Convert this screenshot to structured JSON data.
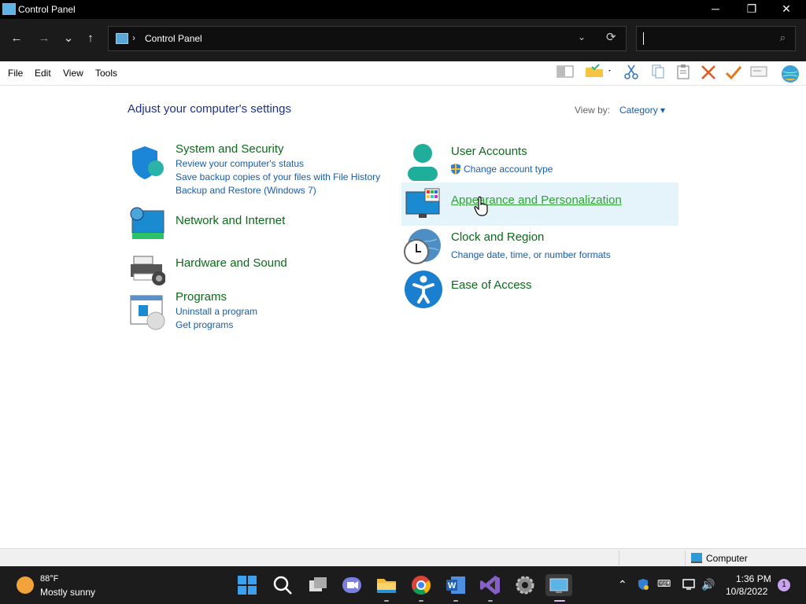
{
  "window": {
    "title": "Control Panel",
    "minimize": "─",
    "restore": "❐",
    "close": "✕"
  },
  "nav": {
    "back": "←",
    "forward": "→",
    "recent": "⌄",
    "up": "↑",
    "chevron": "›",
    "path": "Control Panel",
    "dropdown": "⌄",
    "refresh": "⟳",
    "search_icon": "⌕"
  },
  "menu": {
    "file": "File",
    "edit": "Edit",
    "view": "View",
    "tools": "Tools"
  },
  "content": {
    "heading": "Adjust your computer's settings",
    "view_by_label": "View by:",
    "view_by_value": "Category ▾",
    "left": [
      {
        "title": "System and Security",
        "links": [
          "Review your computer's status",
          "Save backup copies of your files with File History",
          "Backup and Restore (Windows 7)"
        ]
      },
      {
        "title": "Network and Internet",
        "links": []
      },
      {
        "title": "Hardware and Sound",
        "links": []
      },
      {
        "title": "Programs",
        "links": [
          "Uninstall a program",
          "Get programs"
        ]
      }
    ],
    "right": [
      {
        "title": "User Accounts",
        "links": [
          "Change account type"
        ]
      },
      {
        "title": "Appearance and Personalization",
        "links": []
      },
      {
        "title": "Clock and Region",
        "links": [
          "Change date, time, or number formats"
        ]
      },
      {
        "title": "Ease of Access",
        "links": []
      }
    ]
  },
  "status": {
    "location": "Computer"
  },
  "taskbar": {
    "weather_temp": "88°F",
    "weather_desc": "Mostly sunny",
    "time": "1:36 PM",
    "date": "10/8/2022",
    "notifications": "1",
    "apps": [
      "start",
      "search",
      "task-view",
      "teams-chat",
      "file-explorer",
      "chrome",
      "word",
      "visual-studio",
      "settings",
      "control-panel"
    ]
  },
  "colors": {
    "accent_green": "#0a6b19",
    "link_blue": "#1a5ca8",
    "heading_blue": "#1e3287",
    "hover_bg": "#e5f3fb"
  }
}
